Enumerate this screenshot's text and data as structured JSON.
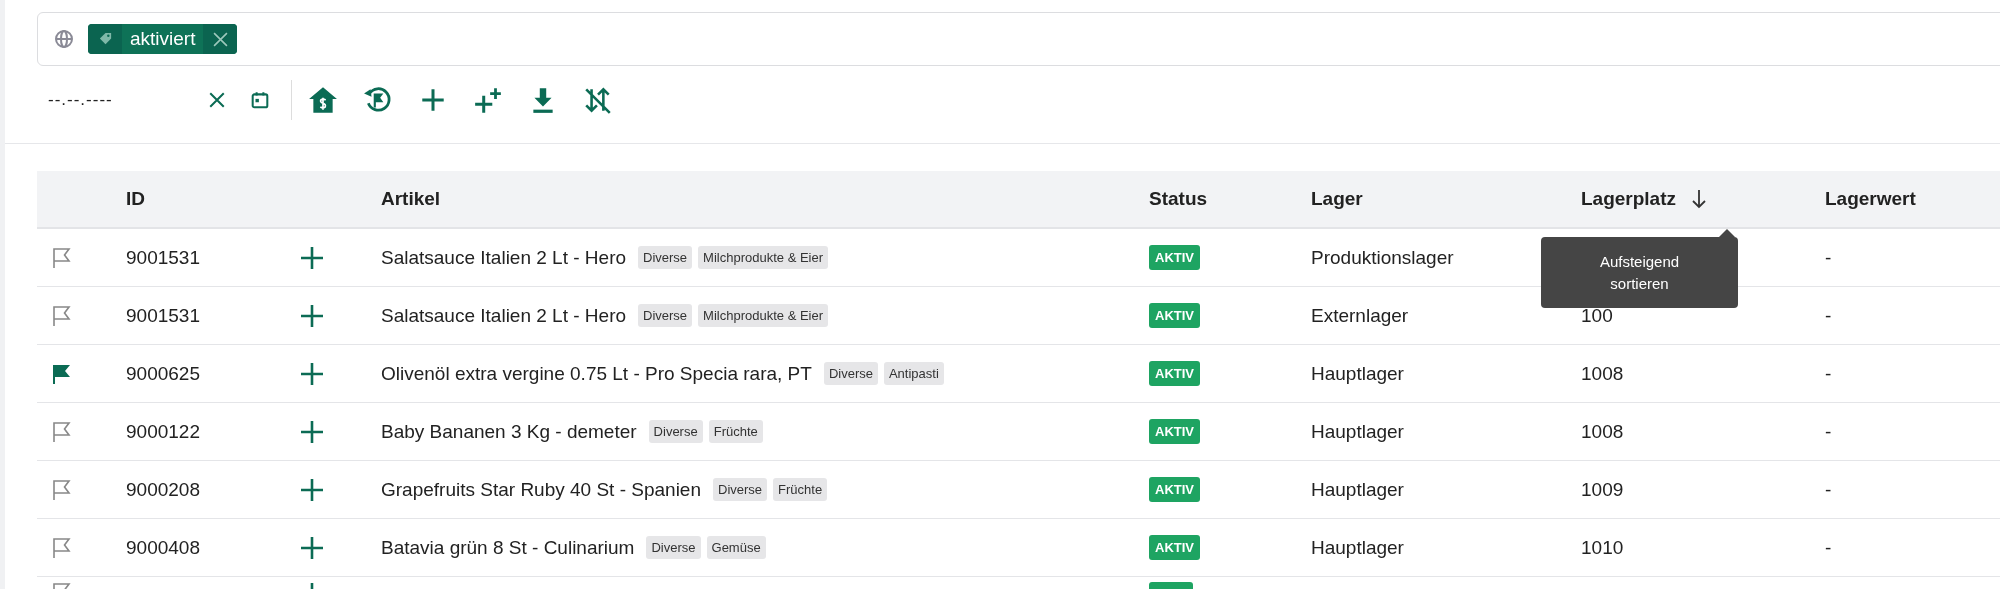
{
  "filter_bar": {
    "chips": [
      {
        "label": "aktiviert"
      }
    ]
  },
  "date_field": {
    "placeholder": "--.--.----"
  },
  "table": {
    "columns": [
      {
        "label": "ID",
        "sort_arrow": false
      },
      {
        "label": "Artikel",
        "sort_arrow": false
      },
      {
        "label": "Status",
        "sort_arrow": false
      },
      {
        "label": "Lager",
        "sort_arrow": false
      },
      {
        "label": "Lagerplatz",
        "sort_arrow": true
      },
      {
        "label": "Lagerwert",
        "sort_arrow": false
      }
    ],
    "rows": [
      {
        "flagged": false,
        "id": "9001531",
        "article": "Salatsauce Italien 2 Lt - Hero",
        "tags": [
          "Diverse",
          "Milchprodukte & Eier"
        ],
        "status": "AKTIV",
        "lager": "Produktionslager",
        "lagerwert": "-"
      },
      {
        "flagged": false,
        "id": "9001531",
        "article": "Salatsauce Italien 2 Lt - Hero",
        "tags": [
          "Diverse",
          "Milchprodukte & Eier"
        ],
        "status": "AKTIV",
        "lager": "Externlager",
        "lagerplatz": "100",
        "lagerwert": "-"
      },
      {
        "flagged": true,
        "id": "9000625",
        "article": "Olivenöl extra vergine 0.75 Lt - Pro Specia rara, PT",
        "tags": [
          "Diverse",
          "Antipasti"
        ],
        "status": "AKTIV",
        "lager": "Hauptlager",
        "lagerplatz": "1008",
        "lagerwert": "-"
      },
      {
        "flagged": false,
        "id": "9000122",
        "article": "Baby Bananen 3 Kg - demeter",
        "tags": [
          "Diverse",
          "Früchte"
        ],
        "status": "AKTIV",
        "lager": "Hauptlager",
        "lagerplatz": "1008",
        "lagerwert": "-"
      },
      {
        "flagged": false,
        "id": "9000208",
        "article": "Grapefruits Star Ruby 40 St - Spanien",
        "tags": [
          "Diverse",
          "Früchte"
        ],
        "status": "AKTIV",
        "lager": "Hauptlager",
        "lagerplatz": "1009",
        "lagerwert": "-"
      },
      {
        "flagged": false,
        "id": "9000408",
        "article": "Batavia grün 8 St - Culinarium",
        "tags": [
          "Diverse",
          "Gemüse"
        ],
        "status": "AKTIV",
        "lager": "Hauptlager",
        "lagerplatz": "1010",
        "lagerwert": "-"
      }
    ],
    "partial_row": {
      "flagged": false
    }
  },
  "tooltip": {
    "text": "Aufsteigend sortieren"
  }
}
